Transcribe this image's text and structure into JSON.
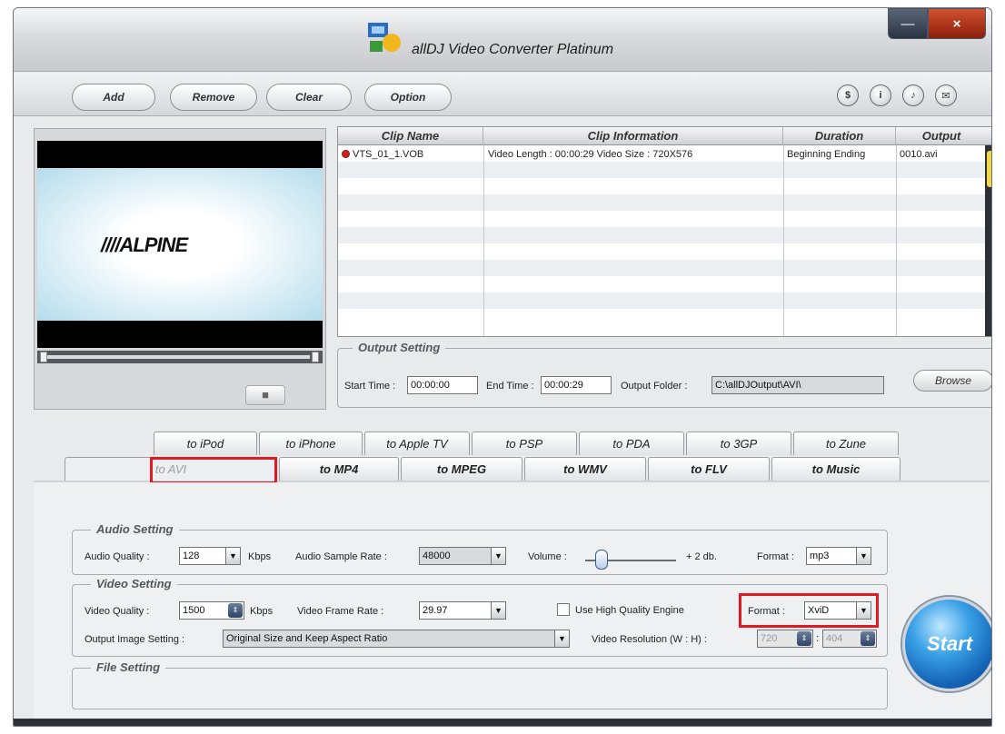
{
  "window": {
    "title": "allDJ Video Converter Platinum",
    "min_label": "—",
    "close_label": "×"
  },
  "toolbar": {
    "buttons": [
      "Add",
      "Remove",
      "Clear",
      "Option"
    ],
    "round_icons": [
      {
        "name": "dollar-icon",
        "glyph": "$"
      },
      {
        "name": "info-icon",
        "glyph": "i"
      },
      {
        "name": "music-icon",
        "glyph": "♪"
      },
      {
        "name": "mail-icon",
        "glyph": "✉"
      }
    ]
  },
  "preview": {
    "logo_text": "////ALPINE",
    "snapshot_glyph": "■"
  },
  "clips": {
    "headers": [
      "Clip Name",
      "Clip Information",
      "Duration",
      "Output"
    ],
    "rows": [
      {
        "name": "VTS_01_1.VOB",
        "info": "Video Length : 00:00:29 Video Size : 720X576",
        "duration": "Beginning Ending",
        "output": "0010.avi"
      }
    ]
  },
  "output_setting": {
    "legend": "Output Setting",
    "start_label": "Start Time :",
    "start_value": "00:00:00",
    "end_label": "End Time :",
    "end_value": "00:00:29",
    "folder_label": "Output Folder :",
    "folder_value": "C:\\allDJOutput\\AVI\\",
    "browse_label": "Browse"
  },
  "tabs_row1": [
    "to iPod",
    "to iPhone",
    "to Apple TV",
    "to PSP",
    "to PDA",
    "to 3GP",
    "to Zune"
  ],
  "tabs_row2": [
    "to AVI",
    "to MP4",
    "to MPEG",
    "to WMV",
    "to FLV",
    "to Music"
  ],
  "active_tab": "to AVI",
  "audio": {
    "legend": "Audio Setting",
    "quality_label": "Audio Quality :",
    "quality_value": "128",
    "quality_unit": "Kbps",
    "rate_label": "Audio Sample Rate :",
    "rate_value": "48000",
    "volume_label": "Volume :",
    "volume_value": "+ 2 db.",
    "format_label": "Format :",
    "format_value": "mp3"
  },
  "video": {
    "legend": "Video Setting",
    "quality_label": "Video Quality :",
    "quality_value": "1500",
    "quality_unit": "Kbps",
    "frame_label": "Video Frame Rate :",
    "frame_value": "29.97",
    "hq_label": "Use High Quality Engine",
    "format_label": "Format :",
    "format_value": "XviD",
    "image_label": "Output Image Setting :",
    "image_value": "Original Size and Keep Aspect Ratio",
    "res_label": "Video Resolution (W : H) :",
    "res_w": "720",
    "res_sep": ":",
    "res_h": "404"
  },
  "file": {
    "legend": "File Setting"
  },
  "start_label": "Start",
  "colors": {
    "highlight": "#e01922",
    "start_blue": "#1565b7"
  }
}
